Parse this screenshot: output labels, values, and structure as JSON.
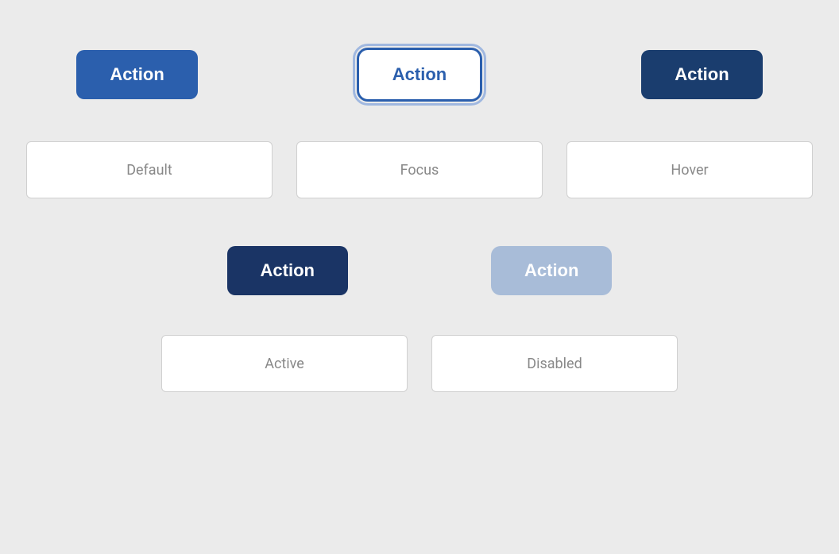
{
  "page": {
    "background": "#ebebeb"
  },
  "row1": {
    "buttons": [
      {
        "id": "default",
        "label": "Action",
        "state": "default"
      },
      {
        "id": "focus",
        "label": "Action",
        "state": "focus"
      },
      {
        "id": "hover",
        "label": "Action",
        "state": "hover"
      }
    ]
  },
  "row2": {
    "labels": [
      {
        "id": "default-label",
        "text": "Default"
      },
      {
        "id": "focus-label",
        "text": "Focus"
      },
      {
        "id": "hover-label",
        "text": "Hover"
      }
    ]
  },
  "row3": {
    "buttons": [
      {
        "id": "active",
        "label": "Action",
        "state": "active"
      },
      {
        "id": "disabled",
        "label": "Action",
        "state": "disabled"
      }
    ]
  },
  "row4": {
    "labels": [
      {
        "id": "active-label",
        "text": "Active"
      },
      {
        "id": "disabled-label",
        "text": "Disabled"
      }
    ]
  }
}
